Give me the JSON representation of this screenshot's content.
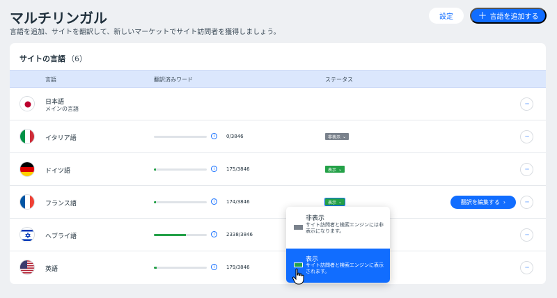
{
  "header": {
    "title": "マルチリンガル",
    "subtitle": "言語を追加、サイトを翻訳して、新しいマーケットでサイト訪問者を獲得しましょう。",
    "settings_label": "設定",
    "add_language_label": "言語を追加する",
    "add_icon": "＋"
  },
  "card": {
    "title": "サイトの言語",
    "count": "（6）",
    "columns": {
      "language": "言語",
      "translated_words": "翻訳済みワード",
      "status": "ステータス"
    }
  },
  "rows": [
    {
      "flag": "japan-flag-icon",
      "name": "日本語",
      "sub": "メインの言語"
    },
    {
      "flag": "italy-flag-icon",
      "name": "イタリア語",
      "progress": 0,
      "words": "0/3846",
      "status": "非表示",
      "status_key": "hidden"
    },
    {
      "flag": "germany-flag-icon",
      "name": "ドイツ語",
      "progress": 0.0455,
      "words": "175/3846",
      "status": "表示",
      "status_key": "shown"
    },
    {
      "flag": "france-flag-icon",
      "name": "フランス語",
      "progress": 0.0452,
      "words": "174/3846",
      "status": "表示",
      "status_key": "shown",
      "edit_label": "翻訳を編集する"
    },
    {
      "flag": "israel-flag-icon",
      "name": "ヘブライ語",
      "progress": 0.6079,
      "words": "2338/3846"
    },
    {
      "flag": "usa-flag-icon",
      "name": "英語",
      "progress": 0.0465,
      "words": "179/3846"
    }
  ],
  "dropdown": {
    "hidden_title": "非表示",
    "hidden_desc": "サイト訪問者と検索エンジンには非表示になります。",
    "shown_title": "表示",
    "shown_desc": "サイト訪問者と検索エンジンに表示されます。"
  },
  "icons": {
    "more": "···",
    "info": "i",
    "chevron": "⌄",
    "edit_arrow": "›"
  },
  "colors": {
    "accent": "#116dff",
    "shown": "#24a148",
    "hidden": "#7a828c"
  }
}
